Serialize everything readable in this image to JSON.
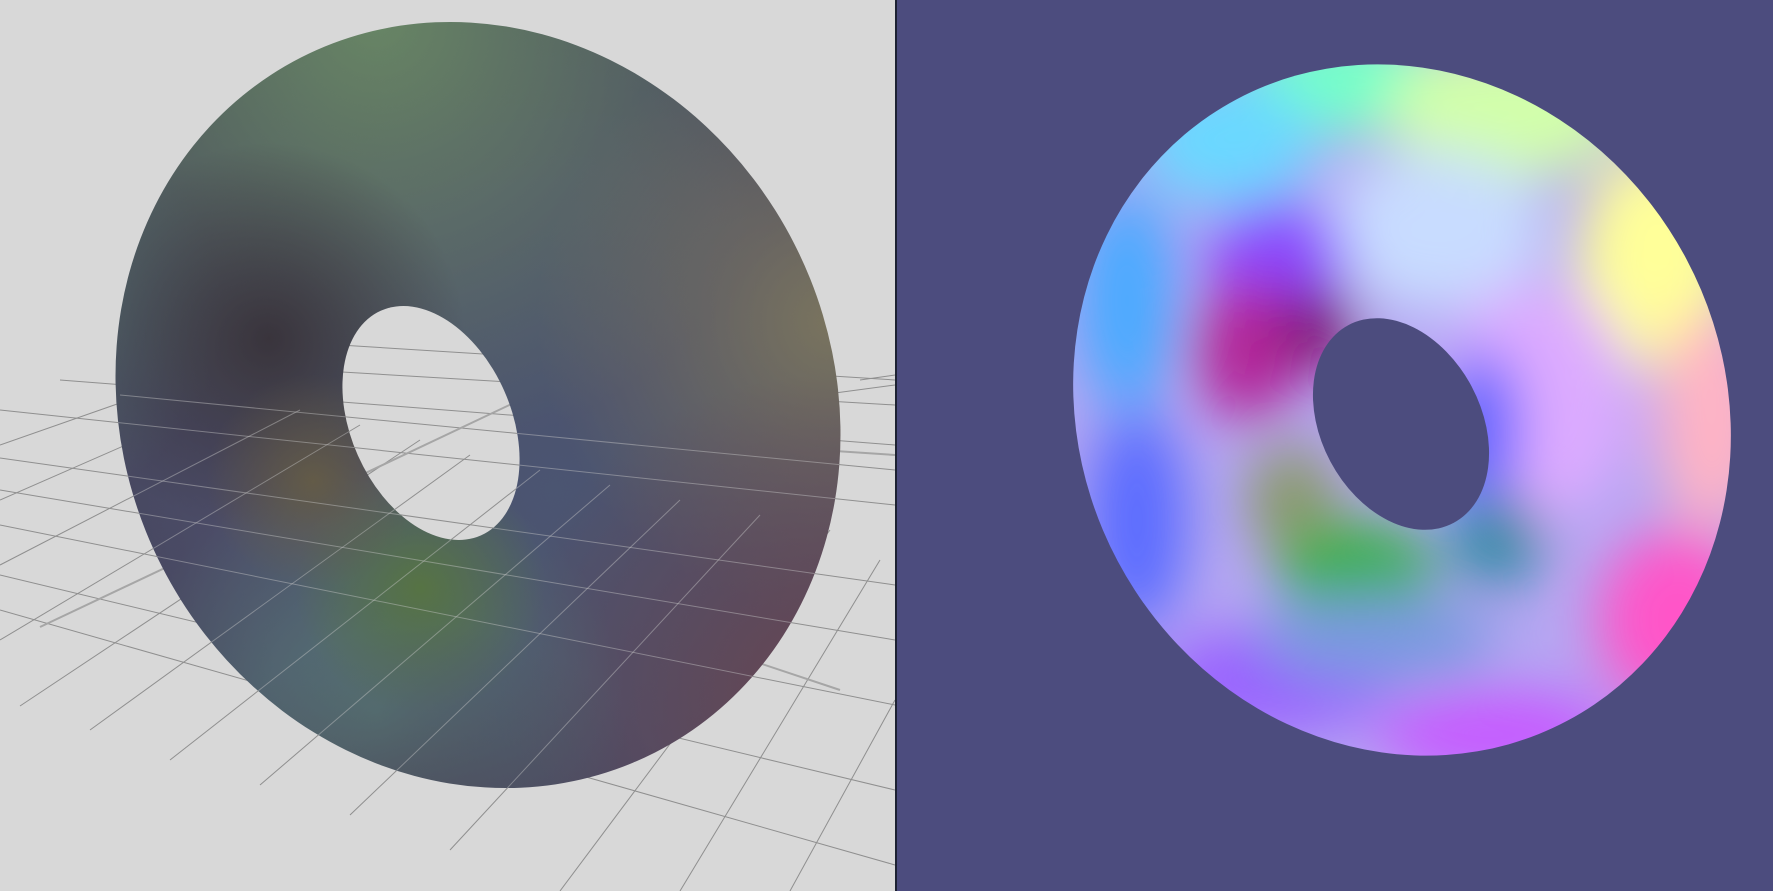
{
  "viewports": {
    "left": {
      "shading": "textured-normal",
      "background_color": "#d8d8d8",
      "grid": true,
      "grid_color": "#8f8f8f",
      "object": "torus"
    },
    "right": {
      "shading": "normal-map",
      "background_color": "#4c4c7e",
      "grid": false,
      "object": "torus"
    }
  },
  "divider": {
    "color": "#1d2233"
  },
  "icons": {
    "left_object": "torus-icon",
    "right_object": "torus-icon"
  }
}
